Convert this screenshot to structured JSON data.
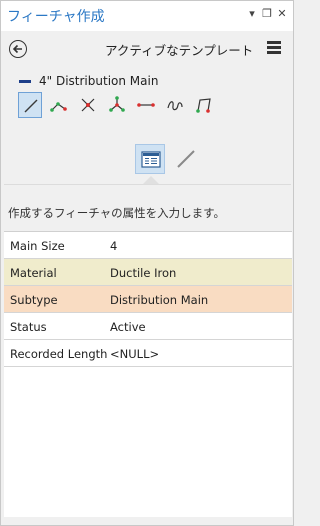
{
  "titlebar": {
    "title": "フィーチャ作成",
    "pin_glyph": "▾",
    "restore_glyph": "❐",
    "close_glyph": "✕"
  },
  "header": {
    "title": "アクティブなテンプレート",
    "back_icon": "back-arrow-circle-icon",
    "menu_icon": "hamburger-menu-icon"
  },
  "template": {
    "name": "4\" Distribution Main",
    "swatch_color": "#1e3f8a"
  },
  "tools": [
    {
      "name": "line-tool",
      "selected": true
    },
    {
      "name": "right-angle-line-tool",
      "selected": false
    },
    {
      "name": "midpoint-line-tool",
      "selected": false
    },
    {
      "name": "endpoint-arc-tool",
      "selected": false
    },
    {
      "name": "distance-distance-tool",
      "selected": false
    },
    {
      "name": "freehand-tool",
      "selected": false
    },
    {
      "name": "trace-tool",
      "selected": false
    }
  ],
  "view_toggle": [
    {
      "name": "attributes-view",
      "selected": true
    },
    {
      "name": "geometry-view",
      "selected": false
    }
  ],
  "instructions": "作成するフィーチャの属性を入力します。",
  "attributes": [
    {
      "field": "Main Size",
      "value": "4",
      "highlight": "none"
    },
    {
      "field": "Material",
      "value": "Ductile Iron",
      "highlight": "yellow"
    },
    {
      "field": "Subtype",
      "value": "Distribution Main",
      "highlight": "orange"
    },
    {
      "field": "Status",
      "value": "Active",
      "highlight": "none"
    },
    {
      "field": "Recorded Length",
      "value": "<NULL>",
      "highlight": "none"
    }
  ],
  "colors": {
    "accent": "#2b78c5",
    "selected_bg": "#cfe2f3",
    "yellow_row": "#f0eccc",
    "orange_row": "#f9dcc2"
  }
}
